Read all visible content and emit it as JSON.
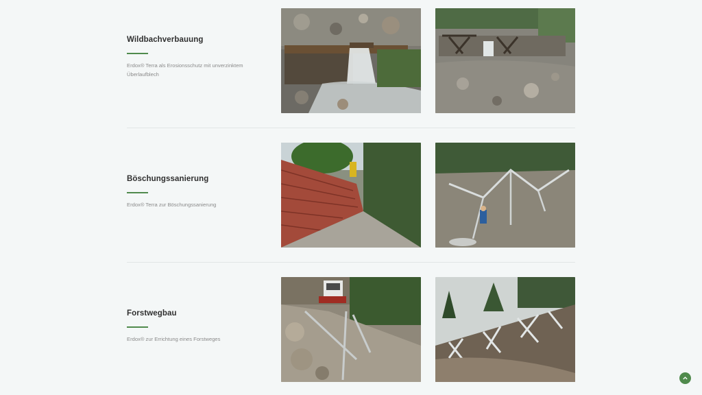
{
  "theme": {
    "accent": "#4f8a4c",
    "background": "#f4f7f7"
  },
  "sections": [
    {
      "title": "Wildbachverbauung",
      "description": "Erdox® Terra als Erosionsschutz mit unverzinktem Überlaufblech",
      "photos": [
        "torrent-weir-waterfall-photo",
        "torrent-check-dams-photo"
      ]
    },
    {
      "title": "Böschungssanierung",
      "description": "Erdox® Terra zur Böschungssanierung",
      "photos": [
        "red-mesh-slope-photo",
        "steel-frame-slope-photo"
      ]
    },
    {
      "title": "Forstwegbau",
      "description": "Erdox® zur Errichtung eines Forstweges",
      "photos": [
        "excavator-slope-photo",
        "frame-embankment-photo"
      ]
    }
  ],
  "scroll_top": {
    "icon": "chevron-up-icon"
  }
}
